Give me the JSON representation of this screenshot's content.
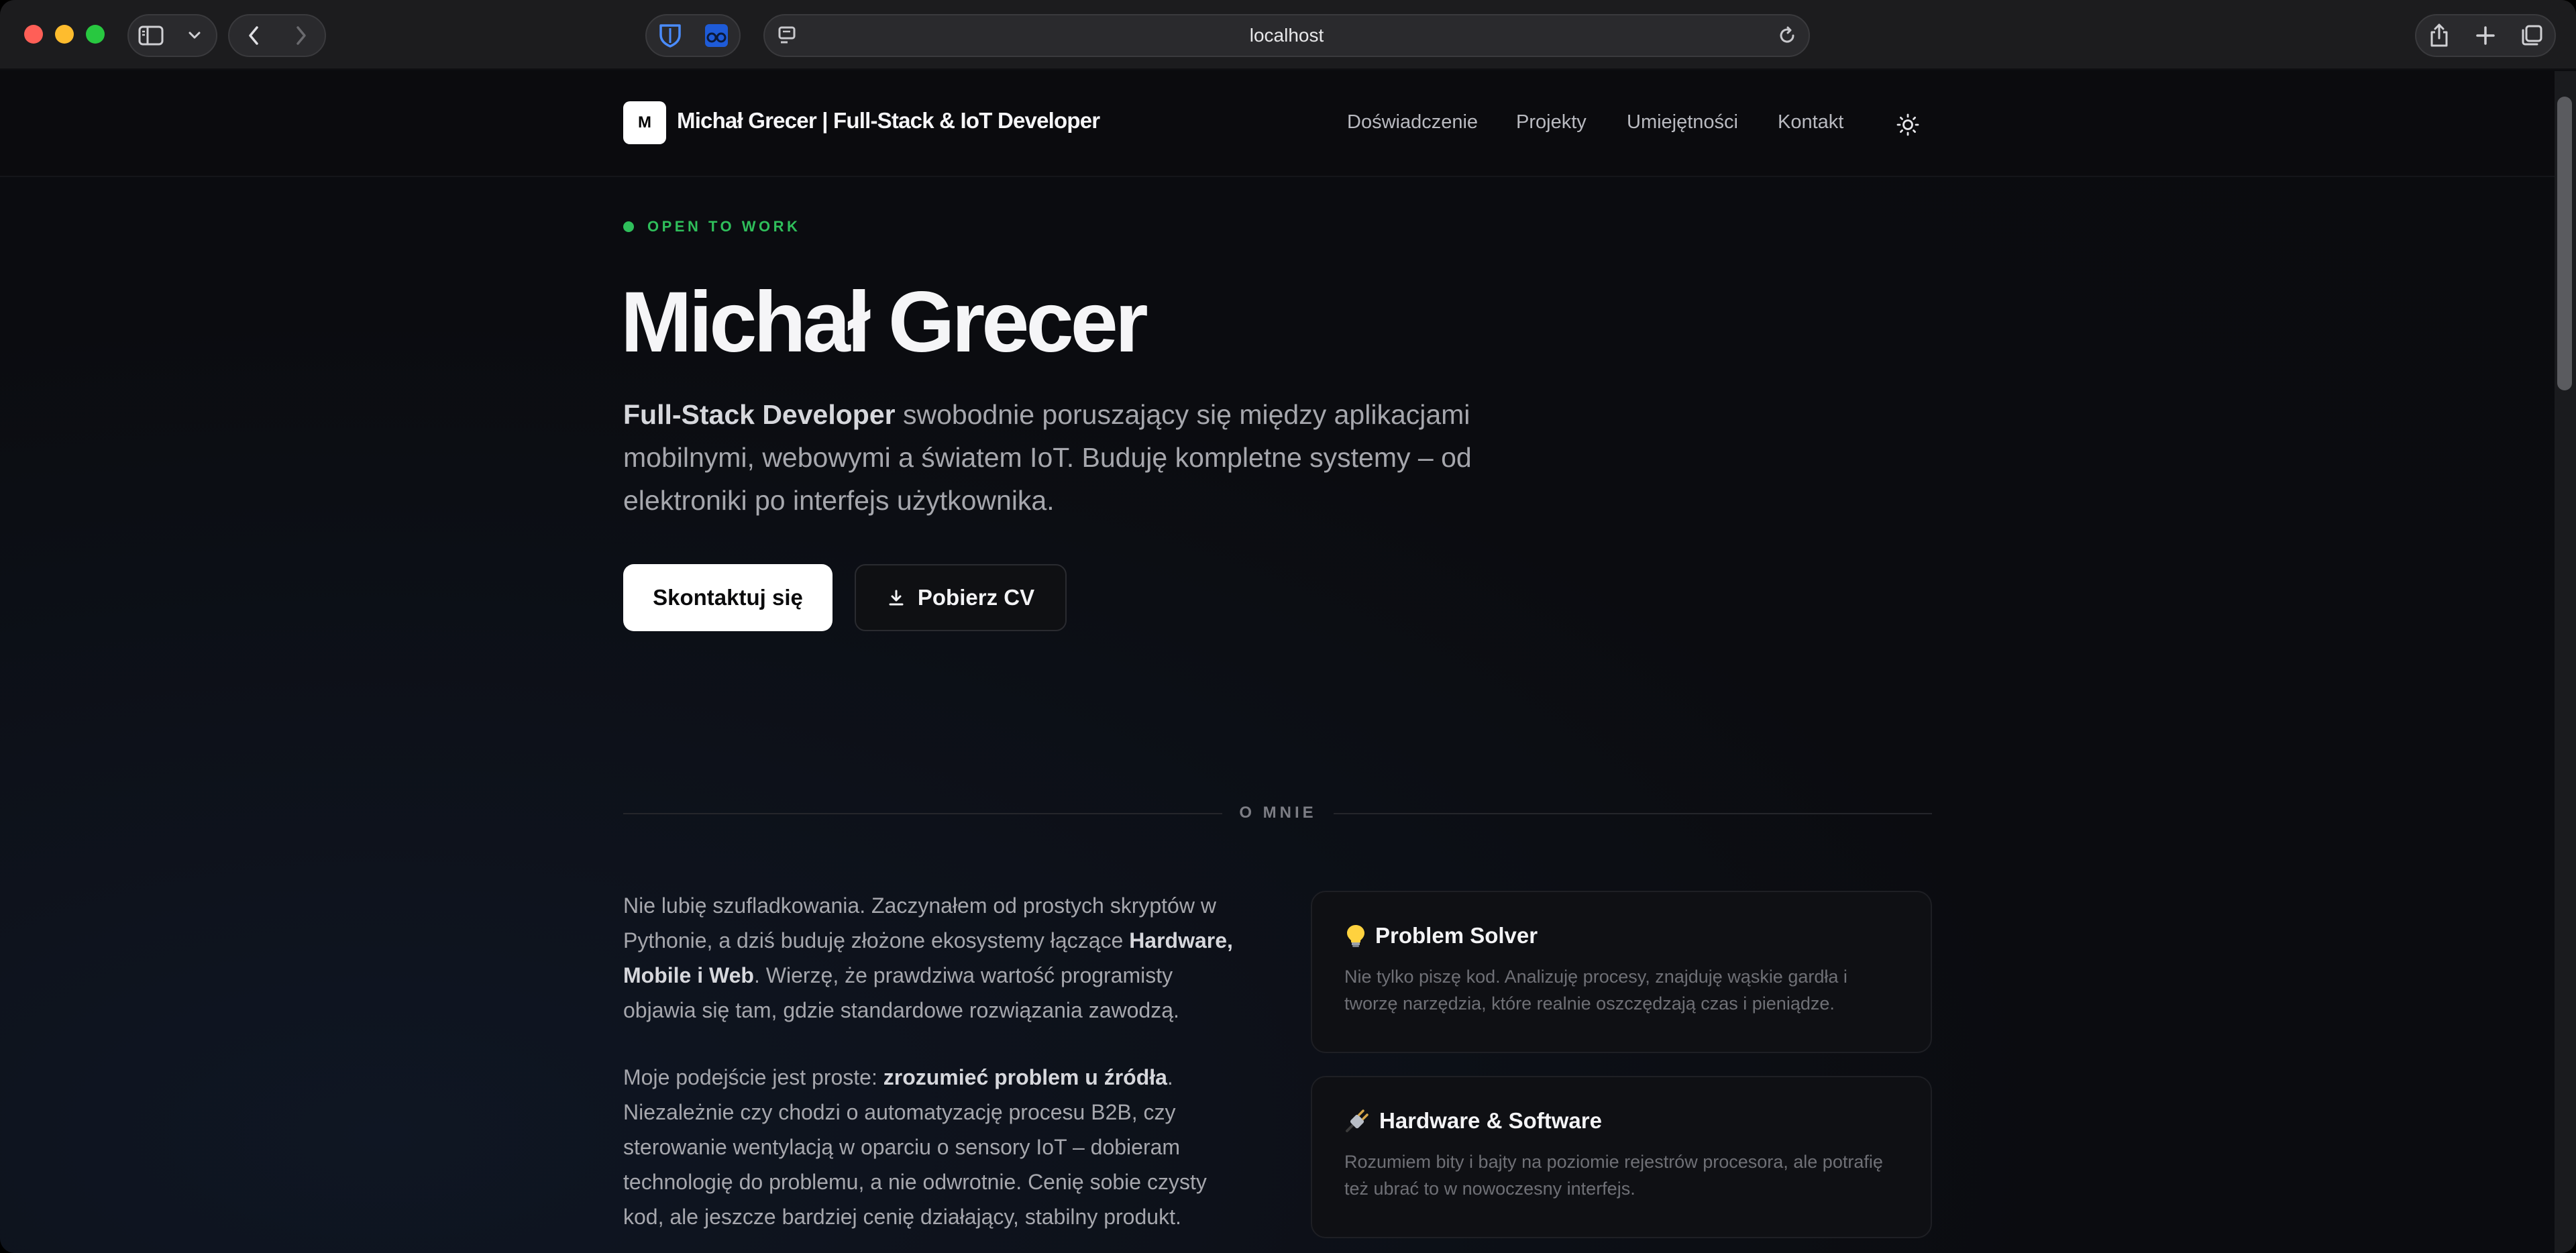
{
  "browser": {
    "url": "localhost"
  },
  "header": {
    "logo_letter": "M",
    "site_name": "Michał Grecer | Full-Stack & IoT Developer",
    "nav": [
      "Doświadczenie",
      "Projekty",
      "Umiejętności",
      "Kontakt"
    ]
  },
  "hero": {
    "status": "OPEN TO WORK",
    "name": "Michał Grecer",
    "desc_bold": "Full-Stack Developer",
    "desc_rest": " swobodnie poruszający się między aplikacjami mobilnymi, webowymi a światem IoT. Buduję kompletne systemy – od elektroniki po interfejs użytkownika.",
    "cta_primary": "Skontaktuj się",
    "cta_secondary": "Pobierz CV"
  },
  "about": {
    "section_label": "O MNIE",
    "p1_a": "Nie lubię szufladkowania. Zaczynałem od prostych skryptów w Pythonie, a dziś buduję złożone ekosystemy łączące ",
    "p1_bold": "Hardware, Mobile i Web",
    "p1_b": ". Wierzę, że prawdziwa wartość programisty objawia się tam, gdzie standardowe rozwiązania zawodzą.",
    "p2_a": "Moje podejście jest proste: ",
    "p2_bold": "zrozumieć problem u źródła",
    "p2_b": ". Niezależnie czy chodzi o automatyzację procesu B2B, czy sterowanie wentylacją w oparciu o sensory IoT – dobieram technologię do problemu, a nie odwrotnie. Cenię sobie czysty kod, ale jeszcze bardziej cenię działający, stabilny produkt.",
    "cards": [
      {
        "icon": "lightbulb-icon",
        "title": "Problem Solver",
        "desc": "Nie tylko piszę kod. Analizuję procesy, znajduję wąskie gardła i tworzę narzędzia, które realnie oszczędzają czas i pieniądze."
      },
      {
        "icon": "plug-icon",
        "title": "Hardware & Software",
        "desc": "Rozumiem bity i bajty na poziomie rejestrów procesora, ale potrafię też ubrać to w nowoczesny interfejs."
      }
    ]
  },
  "colors": {
    "accent_green": "#2fbf5b",
    "background": "#0b0c0f",
    "primary_button": "#ffffff"
  }
}
